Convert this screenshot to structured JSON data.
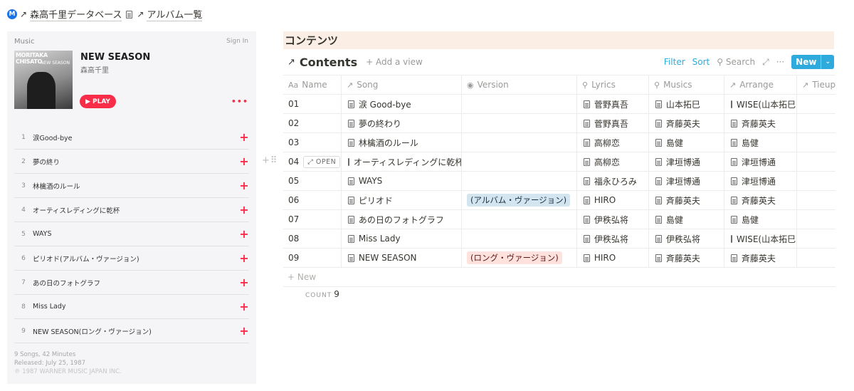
{
  "breadcrumb": {
    "badge": "M",
    "item1": "森高千里データベース",
    "item2": "アルバム一覧"
  },
  "apple_music": {
    "brand": "Music",
    "sign_in": "Sign In",
    "cover_text": "MORITAKA CHISATO",
    "cover_sub": "NEW SEASON",
    "album_title": "NEW SEASON",
    "artist": "森高千里",
    "play_label": "PLAY",
    "more": "•••",
    "tracks": [
      {
        "n": "1",
        "title": "涙Good-bye"
      },
      {
        "n": "2",
        "title": "夢の終り"
      },
      {
        "n": "3",
        "title": "林檎酒のルール"
      },
      {
        "n": "4",
        "title": "オーティスレディングに乾杯"
      },
      {
        "n": "5",
        "title": "WAYS"
      },
      {
        "n": "6",
        "title": "ピリオド(アルバム・ヴァージョン)"
      },
      {
        "n": "7",
        "title": "あの日のフォトグラフ"
      },
      {
        "n": "8",
        "title": "Miss Lady"
      },
      {
        "n": "9",
        "title": "NEW SEASON(ロング・ヴァージョン)"
      }
    ],
    "footer": {
      "songs": "9 Songs, 42 Minutes",
      "released": "Released: July 25, 1987",
      "copyright": "℗ 1987 WARNER MUSIC JAPAN INC."
    }
  },
  "notion": {
    "section_title": "コンテンツ",
    "db_title": "Contents",
    "add_view": "Add a view",
    "filter": "Filter",
    "sort": "Sort",
    "search": "Search",
    "new_label": "New",
    "headers": [
      "Name",
      "Song",
      "Version",
      "Lyrics",
      "Musics",
      "Arrange",
      "Tieup"
    ],
    "open_label": "OPEN",
    "rows": [
      {
        "name": "01",
        "song": "涙 Good-bye",
        "version": "",
        "version_color": "",
        "lyrics": "菅野真吾",
        "musics": "山本拓巳",
        "arrange": "WISE(山本拓巳"
      },
      {
        "name": "02",
        "song": "夢の終わり",
        "version": "",
        "version_color": "",
        "lyrics": "菅野真吾",
        "musics": "斉藤英夫",
        "arrange": "斉藤英夫"
      },
      {
        "name": "03",
        "song": "林檎酒のルール",
        "version": "",
        "version_color": "",
        "lyrics": "高柳恋",
        "musics": "島健",
        "arrange": "島健"
      },
      {
        "name": "04",
        "song": "オーティスレディングに乾杯",
        "version": "",
        "version_color": "",
        "lyrics": "高柳恋",
        "musics": "津垣博通",
        "arrange": "津垣博通"
      },
      {
        "name": "05",
        "song": "WAYS",
        "version": "",
        "version_color": "",
        "lyrics": "福永ひろみ",
        "musics": "津垣博通",
        "arrange": "津垣博通"
      },
      {
        "name": "06",
        "song": "ピリオド",
        "version": "(アルバム・ヴァージョン)",
        "version_color": "blue",
        "lyrics": "HIRO",
        "musics": "斉藤英夫",
        "arrange": "斉藤英夫"
      },
      {
        "name": "07",
        "song": "あの日のフォトグラフ",
        "version": "",
        "version_color": "",
        "lyrics": "伊秩弘将",
        "musics": "島健",
        "arrange": "島健"
      },
      {
        "name": "08",
        "song": "Miss Lady",
        "version": "",
        "version_color": "",
        "lyrics": "伊秩弘将",
        "musics": "伊秩弘将",
        "arrange": "WISE(山本拓巳"
      },
      {
        "name": "09",
        "song": "NEW SEASON",
        "version": "(ロング・ヴァージョン)",
        "version_color": "red",
        "lyrics": "HIRO",
        "musics": "斉藤英夫",
        "arrange": "斉藤英夫"
      }
    ],
    "new_row": "New",
    "count_label": "COUNT",
    "count_value": "9",
    "colors": {
      "accent": "#2eaadc",
      "header_bg": "#fbeee4",
      "apple_red": "#fa2d48"
    }
  }
}
